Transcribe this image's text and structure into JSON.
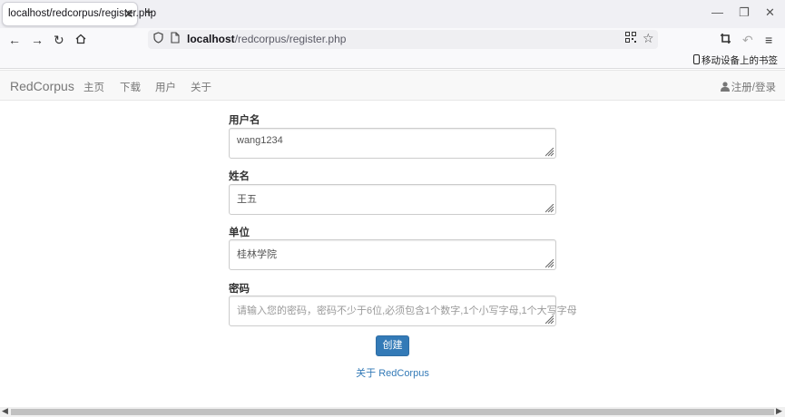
{
  "browser": {
    "tab_title": "localhost/redcorpus/register.php",
    "tab_close": "✕",
    "new_tab": "+",
    "url_host": "localhost",
    "url_path": "/redcorpus/register.php",
    "mobile_bookmarks": "移动设备上的书签"
  },
  "site": {
    "brand": "RedCorpus",
    "nav": [
      "主页",
      "下载",
      "用户",
      "关于"
    ],
    "login": "注册/登录"
  },
  "form": {
    "fields": [
      {
        "label": "用户名",
        "value": "wang1234",
        "placeholder": ""
      },
      {
        "label": "姓名",
        "value": "王五",
        "placeholder": ""
      },
      {
        "label": "单位",
        "value": "桂林学院",
        "placeholder": ""
      },
      {
        "label": "密码",
        "value": "",
        "placeholder": "请输入您的密码，密码不少于6位,必须包含1个数字,1个小写字母,1个大写字母"
      }
    ],
    "submit": "创建",
    "about": "关于 RedCorpus"
  },
  "colors": {
    "primary": "#337ab7",
    "link": "#337ab7"
  }
}
